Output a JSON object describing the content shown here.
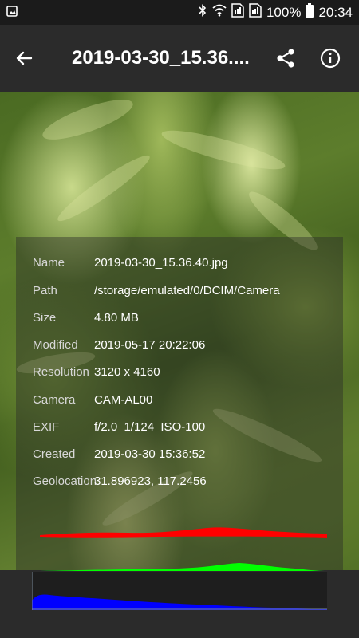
{
  "statusbar": {
    "battery_percent": "100%",
    "time": "20:34"
  },
  "appbar": {
    "title": "2019-03-30_15.36...."
  },
  "info": [
    {
      "label": "Name",
      "value": "2019-03-30_15.36.40.jpg"
    },
    {
      "label": "Path",
      "value": "/storage/emulated/0/DCIM/Camera"
    },
    {
      "label": "Size",
      "value": "4.80 MB"
    },
    {
      "label": "Modified",
      "value": "2019-05-17 20:22:06"
    },
    {
      "label": "Resolution",
      "value": "3120 x 4160"
    },
    {
      "label": "Camera",
      "value": "CAM-AL00"
    },
    {
      "label": "EXIF",
      "value": "f/2.0  1/124  ISO-100"
    },
    {
      "label": "Created",
      "value": "2019-03-30 15:36:52"
    },
    {
      "label": "Geolocation",
      "value": "31.896923, 117.2456"
    }
  ],
  "histogram": {
    "colors": {
      "red": "#ff0000",
      "green": "#00ff00",
      "blue": "#0000ff"
    }
  }
}
